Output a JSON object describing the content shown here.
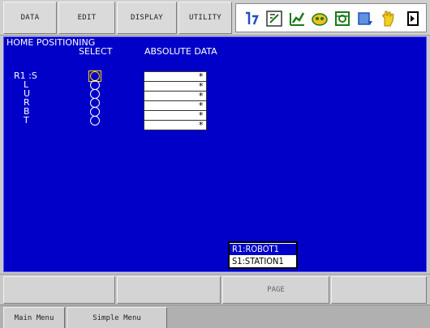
{
  "top_menu": {
    "items": [
      "DATA",
      "EDIT",
      "DISPLAY",
      "UTILITY"
    ]
  },
  "status_icons": [
    "cycle-icon",
    "edit-mode-icon",
    "chart-icon",
    "security-icon",
    "servo-icon",
    "page-icon",
    "hand-icon"
  ],
  "screen": {
    "title": "HOME POSITIONING",
    "col_select": "SELECT",
    "col_absolute": "ABSOLUTE DATA",
    "group_label": "R1 :S",
    "axes": [
      {
        "label": "",
        "selected": true,
        "value": "*"
      },
      {
        "label": "L",
        "selected": false,
        "value": "*"
      },
      {
        "label": "U",
        "selected": false,
        "value": "*"
      },
      {
        "label": "R",
        "selected": false,
        "value": "*"
      },
      {
        "label": "B",
        "selected": false,
        "value": "*"
      },
      {
        "label": "T",
        "selected": false,
        "value": "*"
      }
    ],
    "control_group": {
      "selected": "R1:ROBOT1",
      "other": "S1:STATION1"
    }
  },
  "function_keys": [
    "",
    "",
    "PAGE",
    ""
  ],
  "bottom_tabs": [
    "Main Menu",
    "Simple Menu"
  ]
}
